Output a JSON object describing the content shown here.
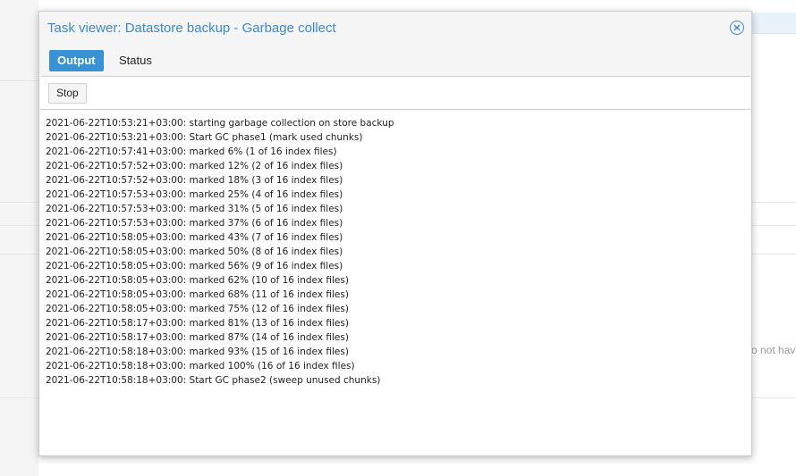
{
  "background": {
    "fragment_text": "o not hav"
  },
  "dialog": {
    "title": "Task viewer: Datastore backup - Garbage collect",
    "close_icon": "close-circle-icon",
    "tabs": [
      {
        "label": "Output",
        "active": true
      },
      {
        "label": "Status",
        "active": false
      }
    ],
    "toolbar": {
      "stop_label": "Stop"
    },
    "log_lines": [
      "2021-06-22T10:53:21+03:00: starting garbage collection on store backup",
      "2021-06-22T10:53:21+03:00: Start GC phase1 (mark used chunks)",
      "2021-06-22T10:57:41+03:00: marked 6% (1 of 16 index files)",
      "2021-06-22T10:57:52+03:00: marked 12% (2 of 16 index files)",
      "2021-06-22T10:57:52+03:00: marked 18% (3 of 16 index files)",
      "2021-06-22T10:57:53+03:00: marked 25% (4 of 16 index files)",
      "2021-06-22T10:57:53+03:00: marked 31% (5 of 16 index files)",
      "2021-06-22T10:57:53+03:00: marked 37% (6 of 16 index files)",
      "2021-06-22T10:58:05+03:00: marked 43% (7 of 16 index files)",
      "2021-06-22T10:58:05+03:00: marked 50% (8 of 16 index files)",
      "2021-06-22T10:58:05+03:00: marked 56% (9 of 16 index files)",
      "2021-06-22T10:58:05+03:00: marked 62% (10 of 16 index files)",
      "2021-06-22T10:58:05+03:00: marked 68% (11 of 16 index files)",
      "2021-06-22T10:58:05+03:00: marked 75% (12 of 16 index files)",
      "2021-06-22T10:58:17+03:00: marked 81% (13 of 16 index files)",
      "2021-06-22T10:58:17+03:00: marked 87% (14 of 16 index files)",
      "2021-06-22T10:58:18+03:00: marked 93% (15 of 16 index files)",
      "2021-06-22T10:58:18+03:00: marked 100% (16 of 16 index files)",
      "2021-06-22T10:58:18+03:00: Start GC phase2 (sweep unused chunks)"
    ]
  },
  "colors": {
    "accent": "#3a8ad0",
    "active_tab_bg": "#3892d4",
    "dialog_bg": "#f5f5f5",
    "border": "#cfcfcf"
  }
}
